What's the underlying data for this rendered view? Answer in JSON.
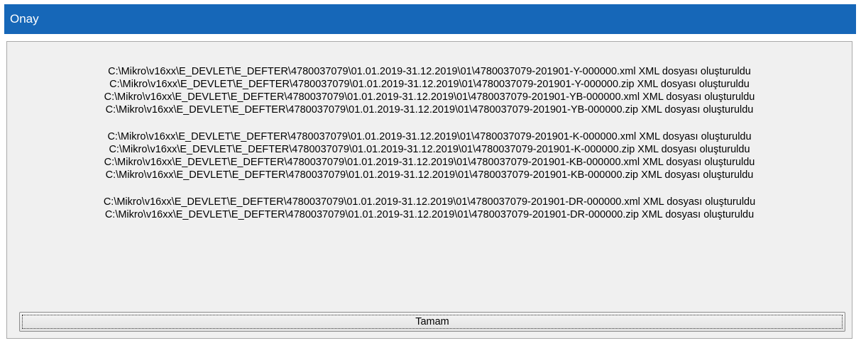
{
  "dialog": {
    "title": "Onay",
    "title_bar_color": "#1667b8",
    "message_groups": [
      {
        "lines": [
          "C:\\Mikro\\v16xx\\E_DEVLET\\E_DEFTER\\4780037079\\01.01.2019-31.12.2019\\01\\4780037079-201901-Y-000000.xml XML dosyası oluşturuldu",
          "C:\\Mikro\\v16xx\\E_DEVLET\\E_DEFTER\\4780037079\\01.01.2019-31.12.2019\\01\\4780037079-201901-Y-000000.zip XML dosyası oluşturuldu",
          "C:\\Mikro\\v16xx\\E_DEVLET\\E_DEFTER\\4780037079\\01.01.2019-31.12.2019\\01\\4780037079-201901-YB-000000.xml XML dosyası oluşturuldu",
          "C:\\Mikro\\v16xx\\E_DEVLET\\E_DEFTER\\4780037079\\01.01.2019-31.12.2019\\01\\4780037079-201901-YB-000000.zip XML dosyası oluşturuldu"
        ]
      },
      {
        "lines": [
          "C:\\Mikro\\v16xx\\E_DEVLET\\E_DEFTER\\4780037079\\01.01.2019-31.12.2019\\01\\4780037079-201901-K-000000.xml XML dosyası oluşturuldu",
          "C:\\Mikro\\v16xx\\E_DEVLET\\E_DEFTER\\4780037079\\01.01.2019-31.12.2019\\01\\4780037079-201901-K-000000.zip XML dosyası oluşturuldu",
          "C:\\Mikro\\v16xx\\E_DEVLET\\E_DEFTER\\4780037079\\01.01.2019-31.12.2019\\01\\4780037079-201901-KB-000000.xml XML dosyası oluşturuldu",
          "C:\\Mikro\\v16xx\\E_DEVLET\\E_DEFTER\\4780037079\\01.01.2019-31.12.2019\\01\\4780037079-201901-KB-000000.zip XML dosyası oluşturuldu"
        ]
      },
      {
        "lines": [
          "C:\\Mikro\\v16xx\\E_DEVLET\\E_DEFTER\\4780037079\\01.01.2019-31.12.2019\\01\\4780037079-201901-DR-000000.xml XML dosyası oluşturuldu",
          "C:\\Mikro\\v16xx\\E_DEVLET\\E_DEFTER\\4780037079\\01.01.2019-31.12.2019\\01\\4780037079-201901-DR-000000.zip XML dosyası oluşturuldu"
        ]
      }
    ],
    "ok_button_label": "Tamam"
  }
}
